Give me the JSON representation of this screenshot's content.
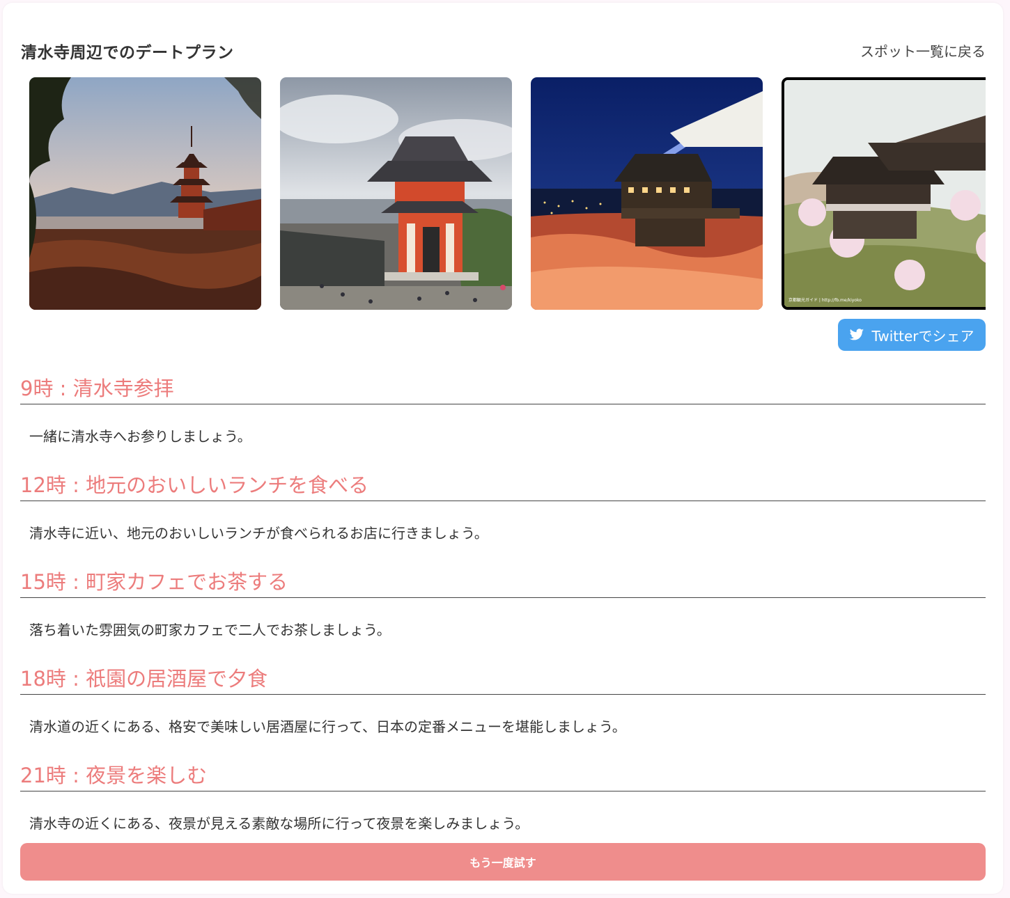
{
  "header": {
    "title": "清水寺周辺でのデートプラン",
    "back_link": "スポット一覧に戻る"
  },
  "gallery": {
    "photos": [
      {
        "subject": "pagoda-sunset"
      },
      {
        "subject": "red-gate-cloudy"
      },
      {
        "subject": "temple-night-illumination"
      },
      {
        "subject": "temple-stage-spring",
        "caption": "京都観光ガイド | http://fb.me/kiyoko"
      }
    ]
  },
  "share": {
    "label": "Twitterでシェア",
    "icon": "twitter-bird-icon"
  },
  "schedule": [
    {
      "heading": "9時 : 清水寺参拝",
      "description": "一緒に清水寺へお参りしましょう。"
    },
    {
      "heading": "12時 : 地元のおいしいランチを食べる",
      "description": "清水寺に近い、地元のおいしいランチが食べられるお店に行きましょう。"
    },
    {
      "heading": "15時 : 町家カフェでお茶する",
      "description": "落ち着いた雰囲気の町家カフェで二人でお茶しましょう。"
    },
    {
      "heading": "18時 : 祇園の居酒屋で夕食",
      "description": "清水道の近くにある、格安で美味しい居酒屋に行って、日本の定番メニューを堪能しましょう。"
    },
    {
      "heading": "21時 : 夜景を楽しむ",
      "description": "清水寺の近くにある、夜景が見える素敵な場所に行って夜景を楽しみましょう。"
    }
  ],
  "retry_button": {
    "label": "もう一度試す"
  },
  "colors": {
    "accent_heading": "#ec7c7c",
    "retry_button": "#ef8d8c",
    "twitter": "#4aa3ef",
    "background": "#fdf6fb"
  }
}
